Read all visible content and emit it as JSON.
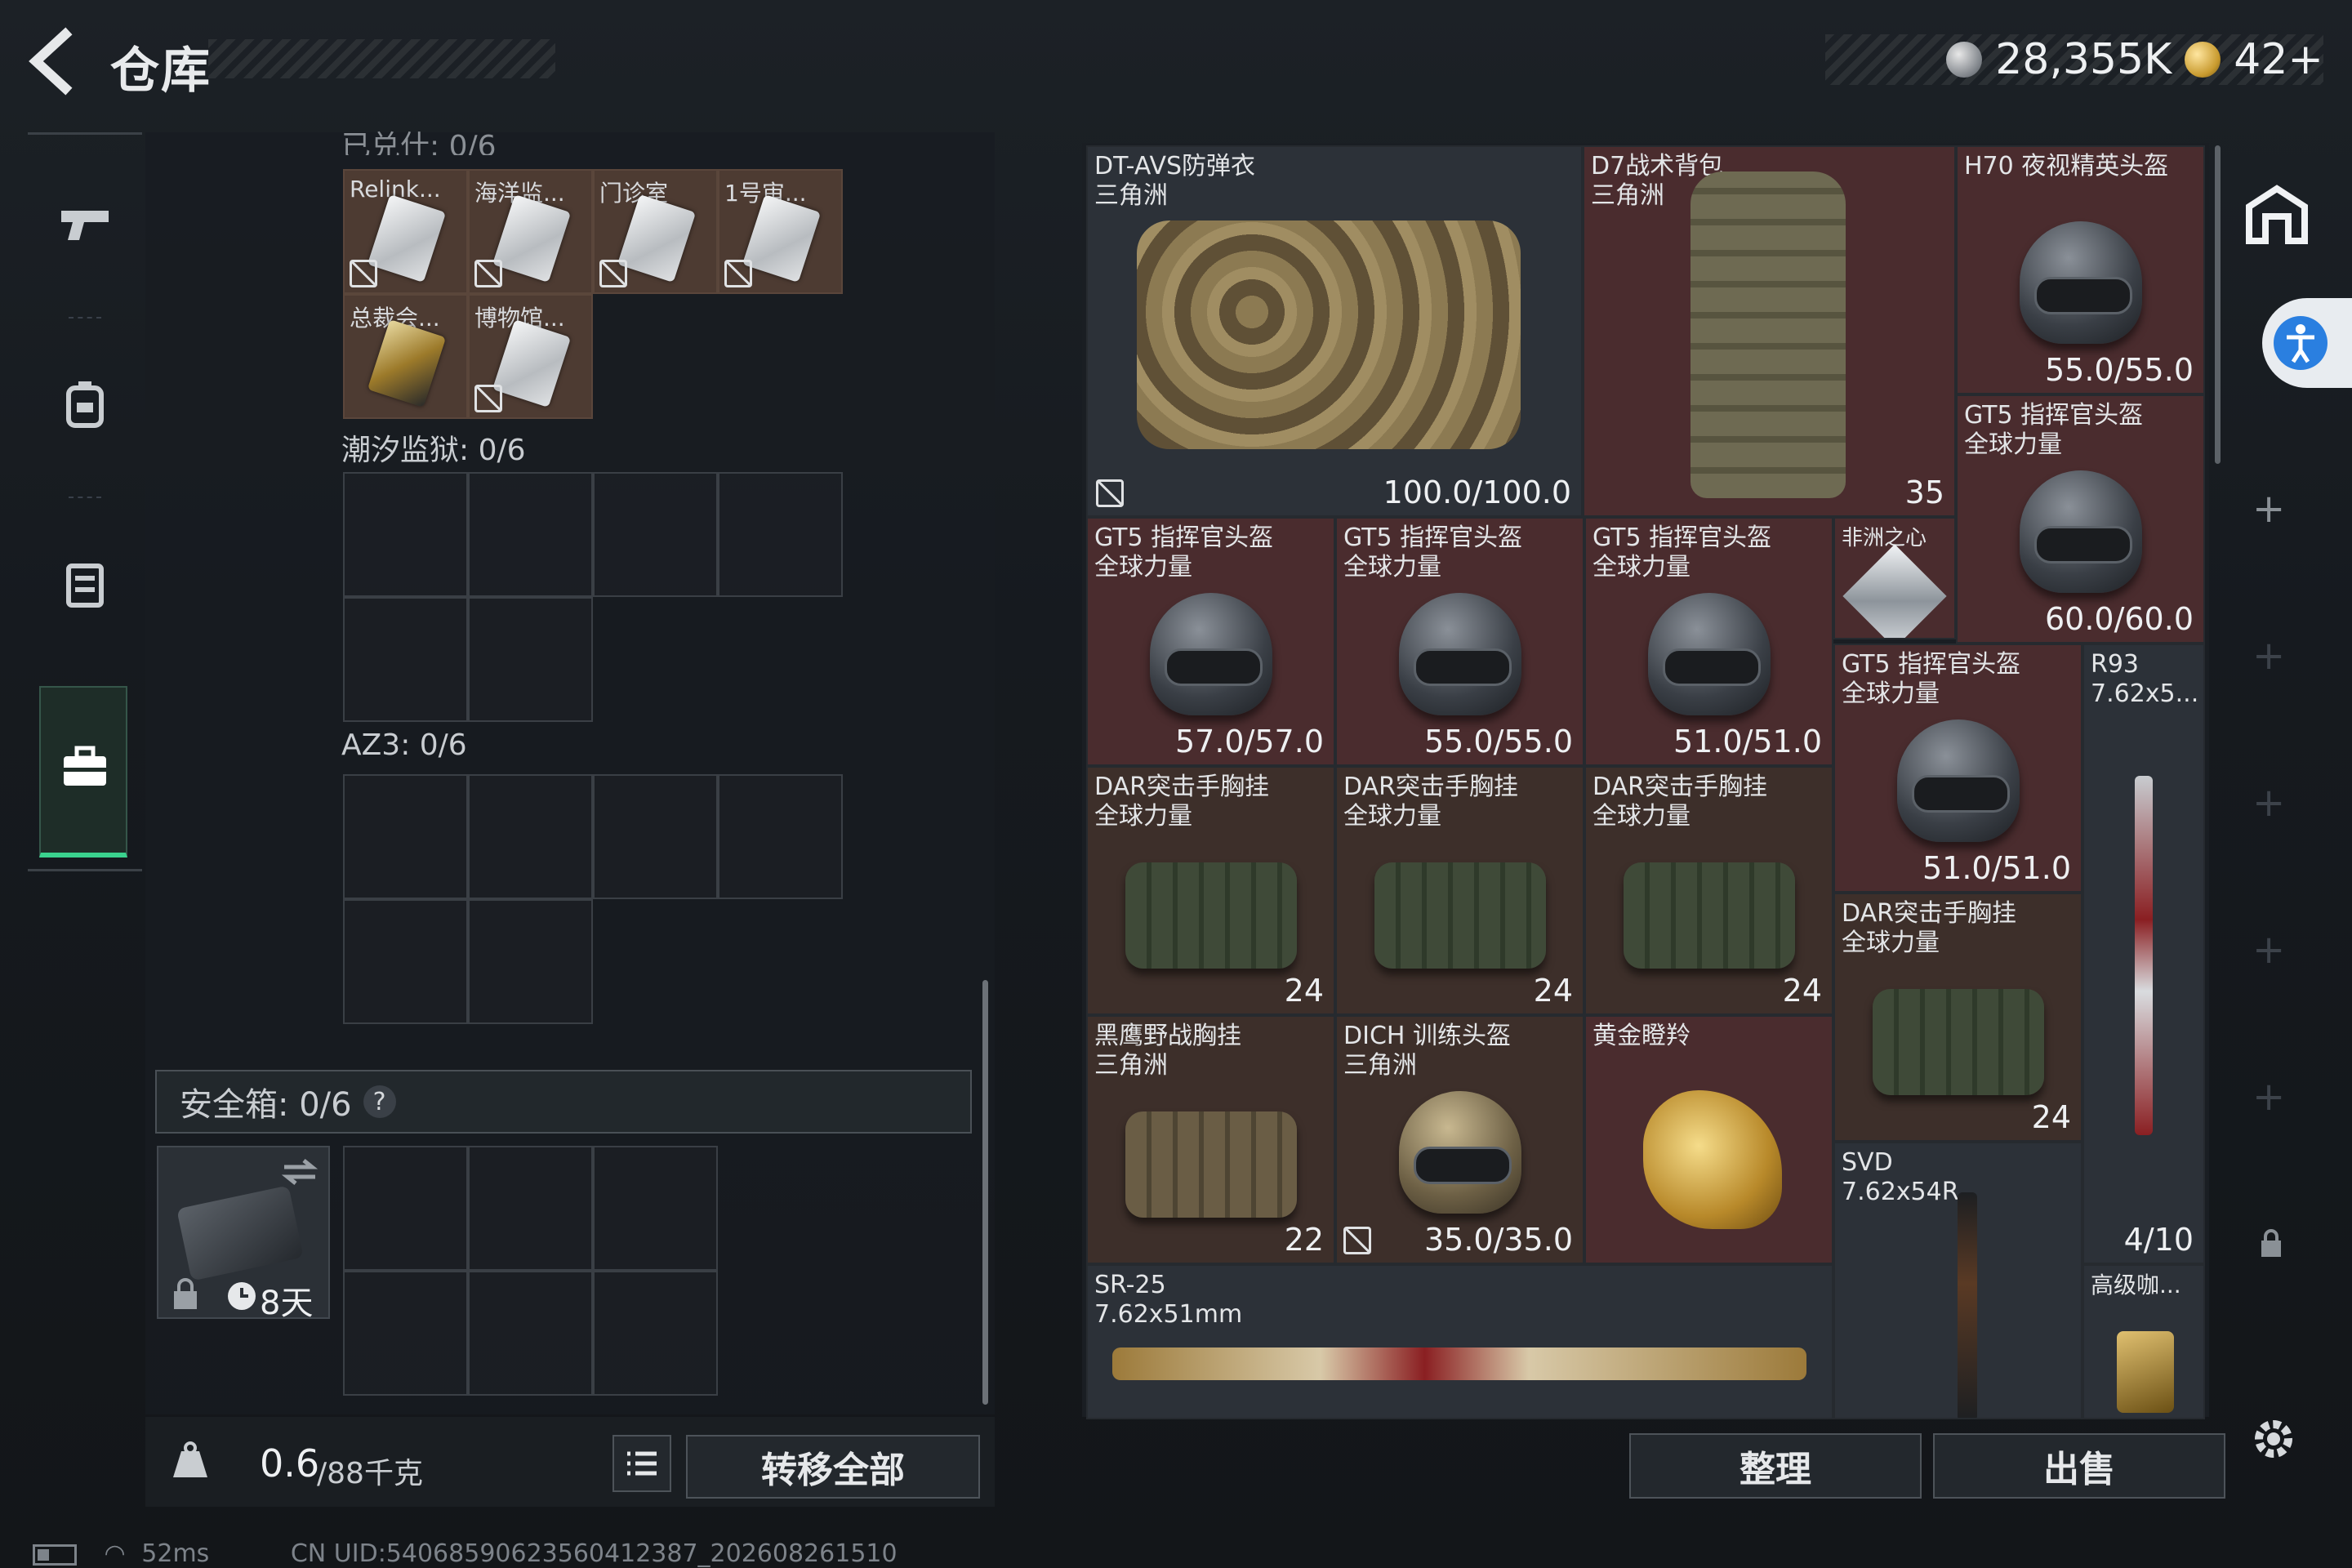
{
  "header": {
    "title": "仓库",
    "currency_silver": "28,355K",
    "currency_gold": "42+"
  },
  "nav": [
    {
      "icon": "gun-icon"
    },
    {
      "icon": "backpack-icon"
    },
    {
      "icon": "vest-icon"
    },
    {
      "icon": "toolbox-icon",
      "active": true
    }
  ],
  "left": {
    "partial_header": "已兑什: 0/6",
    "keys": [
      "Relink...",
      "海洋监...",
      "门诊室",
      "1号审...",
      "总裁会...",
      "博物馆..."
    ],
    "sections": [
      {
        "title": "潮汐监狱: 0/6"
      },
      {
        "title": "AZ3: 0/6"
      }
    ],
    "safe": {
      "label": "安全箱: 0/6",
      "help": "?",
      "time": "8天"
    },
    "weight": {
      "current": "0.6",
      "max": "/88千克"
    },
    "transfer_all": "转移全部"
  },
  "stash": {
    "items": [
      {
        "name": "DT-AVS防弹衣",
        "sub": "三角洲",
        "value": "100.0/100.0"
      },
      {
        "name": "D7战术背包",
        "sub": "三角洲",
        "value": "35"
      },
      {
        "name": "H70 夜视精英头盔",
        "sub": "",
        "value": "55.0/55.0"
      },
      {
        "name": "GT5 指挥官头盔",
        "sub": "全球力量",
        "value": "60.0/60.0"
      },
      {
        "name": "GT5 指挥官头盔",
        "sub": "全球力量",
        "value": "57.0/57.0"
      },
      {
        "name": "GT5 指挥官头盔",
        "sub": "全球力量",
        "value": "55.0/55.0"
      },
      {
        "name": "GT5 指挥官头盔",
        "sub": "全球力量",
        "value": "51.0/51.0"
      },
      {
        "name": "非洲之心",
        "sub": "",
        "value": ""
      },
      {
        "name": "GT5 指挥官头盔",
        "sub": "全球力量",
        "value": "51.0/51.0"
      },
      {
        "name": "R93",
        "sub": "7.62x5...",
        "value": "4/10"
      },
      {
        "name": "DAR突击手胸挂",
        "sub": "全球力量",
        "value": "24"
      },
      {
        "name": "DAR突击手胸挂",
        "sub": "全球力量",
        "value": "24"
      },
      {
        "name": "DAR突击手胸挂",
        "sub": "全球力量",
        "value": "24"
      },
      {
        "name": "DAR突击手胸挂",
        "sub": "全球力量",
        "value": "24"
      },
      {
        "name": "黑鹰野战胸挂",
        "sub": "三角洲",
        "value": "22"
      },
      {
        "name": "DICH 训练头盔",
        "sub": "三角洲",
        "value": "35.0/35.0"
      },
      {
        "name": "黄金瞪羚",
        "sub": "",
        "value": ""
      },
      {
        "name": "SVD",
        "sub": "7.62x54R",
        "value": ""
      },
      {
        "name": "SR-25",
        "sub": "7.62x51mm",
        "value": ""
      },
      {
        "name": "高级咖...",
        "sub": "",
        "value": ""
      }
    ],
    "sort": "整理",
    "sell": "出售"
  },
  "status": {
    "ping": "52ms",
    "uid": "CN UID:5406859062356041238​7_202608261510"
  },
  "colors": {
    "accent": "#3ad28e",
    "item_red": "#4a2c2e",
    "item_grey": "#2c3138",
    "access": "#2a7fe0"
  }
}
